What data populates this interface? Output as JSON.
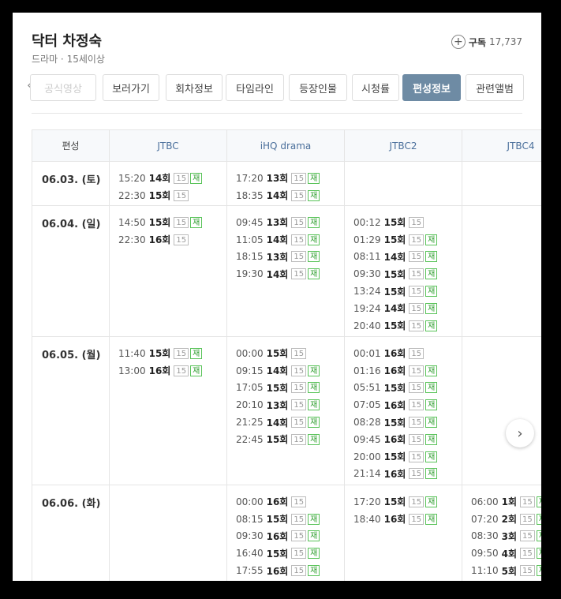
{
  "header": {
    "title": "닥터 차정숙",
    "subtitle": "드라마 · 15세이상",
    "subscribe_icon": "plus-circle-icon",
    "subscribe_label": "구독",
    "subscribe_count": "17,737"
  },
  "tabs": [
    {
      "label": "공식영상",
      "active": false
    },
    {
      "label": "보러가기",
      "active": false
    },
    {
      "label": "회차정보",
      "active": false
    },
    {
      "label": "타임라인",
      "active": false
    },
    {
      "label": "등장인물",
      "active": false
    },
    {
      "label": "시청률",
      "active": false
    },
    {
      "label": "편성정보",
      "active": true
    },
    {
      "label": "관련앨범",
      "active": false
    }
  ],
  "schedule": {
    "header_label": "편성",
    "channels": [
      "JTBC",
      "iHQ drama",
      "JTBC2",
      "JTBC4"
    ],
    "rows": [
      {
        "date": "06.03. (토)",
        "cells": [
          [
            {
              "time": "15:20",
              "ep": "14회",
              "rating": "15",
              "rerun": "재"
            },
            {
              "time": "22:30",
              "ep": "15회",
              "rating": "15",
              "rerun": ""
            }
          ],
          [
            {
              "time": "17:20",
              "ep": "13회",
              "rating": "15",
              "rerun": "재"
            },
            {
              "time": "18:35",
              "ep": "14회",
              "rating": "15",
              "rerun": "재"
            }
          ],
          [],
          []
        ]
      },
      {
        "date": "06.04. (일)",
        "cells": [
          [
            {
              "time": "14:50",
              "ep": "15회",
              "rating": "15",
              "rerun": "재"
            },
            {
              "time": "22:30",
              "ep": "16회",
              "rating": "15",
              "rerun": ""
            }
          ],
          [
            {
              "time": "09:45",
              "ep": "13회",
              "rating": "15",
              "rerun": "재"
            },
            {
              "time": "11:05",
              "ep": "14회",
              "rating": "15",
              "rerun": "재"
            },
            {
              "time": "18:15",
              "ep": "13회",
              "rating": "15",
              "rerun": "재"
            },
            {
              "time": "19:30",
              "ep": "14회",
              "rating": "15",
              "rerun": "재"
            }
          ],
          [
            {
              "time": "00:12",
              "ep": "15회",
              "rating": "15",
              "rerun": ""
            },
            {
              "time": "01:29",
              "ep": "15회",
              "rating": "15",
              "rerun": "재"
            },
            {
              "time": "08:11",
              "ep": "14회",
              "rating": "15",
              "rerun": "재"
            },
            {
              "time": "09:30",
              "ep": "15회",
              "rating": "15",
              "rerun": "재"
            },
            {
              "time": "13:24",
              "ep": "15회",
              "rating": "15",
              "rerun": "재"
            },
            {
              "time": "19:24",
              "ep": "14회",
              "rating": "15",
              "rerun": "재"
            },
            {
              "time": "20:40",
              "ep": "15회",
              "rating": "15",
              "rerun": "재"
            }
          ],
          []
        ]
      },
      {
        "date": "06.05. (월)",
        "cells": [
          [
            {
              "time": "11:40",
              "ep": "15회",
              "rating": "15",
              "rerun": "재"
            },
            {
              "time": "13:00",
              "ep": "16회",
              "rating": "15",
              "rerun": "재"
            }
          ],
          [
            {
              "time": "00:00",
              "ep": "15회",
              "rating": "15",
              "rerun": ""
            },
            {
              "time": "09:15",
              "ep": "14회",
              "rating": "15",
              "rerun": "재"
            },
            {
              "time": "17:05",
              "ep": "15회",
              "rating": "15",
              "rerun": "재"
            },
            {
              "time": "20:10",
              "ep": "13회",
              "rating": "15",
              "rerun": "재"
            },
            {
              "time": "21:25",
              "ep": "14회",
              "rating": "15",
              "rerun": "재"
            },
            {
              "time": "22:45",
              "ep": "15회",
              "rating": "15",
              "rerun": "재"
            }
          ],
          [
            {
              "time": "00:01",
              "ep": "16회",
              "rating": "15",
              "rerun": ""
            },
            {
              "time": "01:16",
              "ep": "16회",
              "rating": "15",
              "rerun": "재"
            },
            {
              "time": "05:51",
              "ep": "15회",
              "rating": "15",
              "rerun": "재"
            },
            {
              "time": "07:05",
              "ep": "16회",
              "rating": "15",
              "rerun": "재"
            },
            {
              "time": "08:28",
              "ep": "15회",
              "rating": "15",
              "rerun": "재"
            },
            {
              "time": "09:45",
              "ep": "16회",
              "rating": "15",
              "rerun": "재"
            },
            {
              "time": "20:00",
              "ep": "15회",
              "rating": "15",
              "rerun": "재"
            },
            {
              "time": "21:14",
              "ep": "16회",
              "rating": "15",
              "rerun": "재"
            }
          ],
          []
        ]
      },
      {
        "date": "06.06. (화)",
        "cells": [
          [],
          [
            {
              "time": "00:00",
              "ep": "16회",
              "rating": "15",
              "rerun": ""
            },
            {
              "time": "08:15",
              "ep": "15회",
              "rating": "15",
              "rerun": "재"
            },
            {
              "time": "09:30",
              "ep": "16회",
              "rating": "15",
              "rerun": "재"
            },
            {
              "time": "16:40",
              "ep": "15회",
              "rating": "15",
              "rerun": "재"
            },
            {
              "time": "17:55",
              "ep": "16회",
              "rating": "15",
              "rerun": "재"
            }
          ],
          [
            {
              "time": "17:20",
              "ep": "15회",
              "rating": "15",
              "rerun": "재"
            },
            {
              "time": "18:40",
              "ep": "16회",
              "rating": "15",
              "rerun": "재"
            }
          ],
          [
            {
              "time": "06:00",
              "ep": "1회",
              "rating": "15",
              "rerun": "재"
            },
            {
              "time": "07:20",
              "ep": "2회",
              "rating": "15",
              "rerun": "재"
            },
            {
              "time": "08:30",
              "ep": "3회",
              "rating": "15",
              "rerun": "재"
            },
            {
              "time": "09:50",
              "ep": "4회",
              "rating": "15",
              "rerun": "재"
            },
            {
              "time": "11:10",
              "ep": "5회",
              "rating": "15",
              "rerun": "재"
            }
          ]
        ]
      }
    ]
  },
  "nav": {
    "prev_icon": "chevron-left-icon",
    "next_icon": "chevron-right-icon"
  },
  "colors": {
    "accent": "#6e8ba4",
    "channel": "#4a6f9b",
    "rerun": "#2e9e2e"
  }
}
